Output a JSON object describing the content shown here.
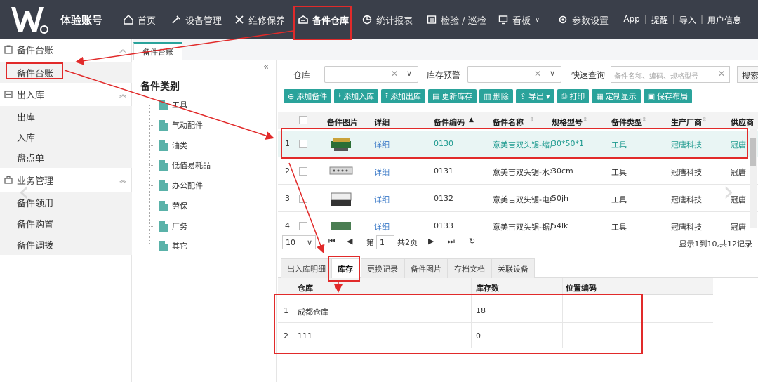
{
  "brand": {
    "title": "体验账号"
  },
  "nav": [
    {
      "label": "首页",
      "icon": "home-icon"
    },
    {
      "label": "设备管理",
      "icon": "tools-icon"
    },
    {
      "label": "维修保养",
      "icon": "wrench-icon"
    },
    {
      "label": "备件仓库",
      "icon": "warehouse-icon"
    },
    {
      "label": "统计报表",
      "icon": "pie-chart-icon"
    },
    {
      "label": "检验 / 巡检",
      "icon": "checklist-icon"
    },
    {
      "label": "看板",
      "icon": "monitor-icon"
    },
    {
      "label": "参数设置",
      "icon": "gear-icon"
    }
  ],
  "topright": {
    "app": "App",
    "remind": "提醒",
    "import": "导入",
    "user": "用户信息"
  },
  "sidebar": {
    "sections": [
      {
        "label": "备件台账",
        "icon": "clipboard-icon"
      },
      {
        "label": "出入库",
        "icon": "inout-icon"
      },
      {
        "label": "业务管理",
        "icon": "briefcase-icon"
      }
    ],
    "items": [
      "备件台账",
      "出库",
      "入库",
      "盘点单",
      "备件领用",
      "备件购置",
      "备件调拨"
    ]
  },
  "tab": {
    "label": "备件台账"
  },
  "category": {
    "title": "备件类别",
    "nodes": [
      "工具",
      "气动配件",
      "油类",
      "低值易耗品",
      "办公配件",
      "劳保",
      "厂务",
      "其它"
    ]
  },
  "filter": {
    "warehouse_label": "仓库",
    "alert_label": "库存预警",
    "quick_label": "快速查询",
    "quick_placeholder": "备件名称、编码、规格型号",
    "search_btn": "搜索"
  },
  "toolbar": [
    "添加备件",
    "添加入库",
    "添加出库",
    "更新库存",
    "删除",
    "导出",
    "打印",
    "定制显示",
    "保存布局"
  ],
  "grid": {
    "headers": [
      "备件图片",
      "详细",
      "备件编码",
      "备件名称",
      "规格型号",
      "备件类型",
      "生产厂商",
      "供应商"
    ],
    "rows": [
      {
        "no": "1",
        "detail": "详细",
        "code": "0130",
        "name": "意美吉双头锯-缩片",
        "spec": "30*50*1",
        "type": "工具",
        "maker": "冠唐科技",
        "supplier": "冠唐"
      },
      {
        "no": "2",
        "detail": "详细",
        "code": "0131",
        "name": "意美吉双头锯-水平",
        "spec": "30cm",
        "type": "工具",
        "maker": "冠唐科技",
        "supplier": "冠唐"
      },
      {
        "no": "3",
        "detail": "详细",
        "code": "0132",
        "name": "意美吉双头锯-电缆",
        "spec": "50jh",
        "type": "工具",
        "maker": "冠唐科技",
        "supplier": "冠唐"
      },
      {
        "no": "4",
        "detail": "详细",
        "code": "0133",
        "name": "意美吉双头锯-锯片",
        "spec": "54lk",
        "type": "工具",
        "maker": "冠唐科技",
        "supplier": "冠唐"
      }
    ]
  },
  "pager": {
    "size": "10",
    "page_prefix": "第",
    "page": "1",
    "total_pages": "共2页",
    "info": "显示1到10,共12记录"
  },
  "subtabs": [
    "出入库明细",
    "库存",
    "更换记录",
    "备件图片",
    "存档文档",
    "关联设备"
  ],
  "stock": {
    "headers": [
      "仓库",
      "库存数",
      "位置编码"
    ],
    "rows": [
      {
        "no": "1",
        "warehouse": "成都仓库",
        "qty": "18",
        "loc": ""
      },
      {
        "no": "2",
        "warehouse": "111",
        "qty": "0",
        "loc": ""
      }
    ]
  },
  "colors": {
    "accent": "#2aa39b",
    "topbar": "#3a3f4a",
    "highlight": "#e12a2a"
  }
}
